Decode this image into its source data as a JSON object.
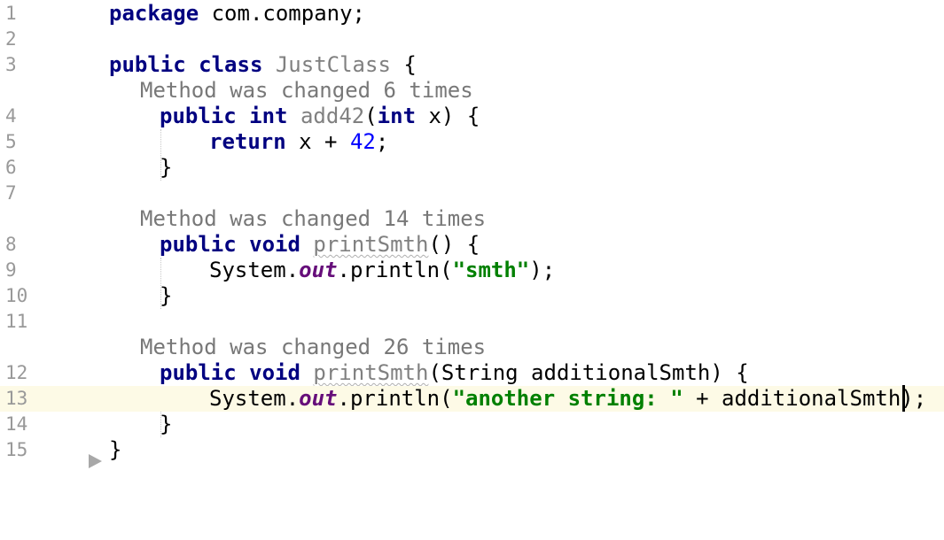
{
  "editor": {
    "lines": {
      "l1": {
        "num": "1",
        "kw": "package",
        "rest": " com.company;"
      },
      "l2": {
        "num": "2"
      },
      "l3": {
        "num": "3",
        "kw1": "public",
        "kw2": "class",
        "name": "JustClass",
        "brace": " {"
      },
      "hint1": "Method was changed 6 times",
      "l4": {
        "num": "4",
        "kw1": "public",
        "kw2": "int",
        "name": "add42",
        "p1": "(",
        "kw3": "int",
        "p2": " x) {"
      },
      "l5": {
        "num": "5",
        "kw": "return",
        "mid": " x + ",
        "value": "42",
        "end": ";"
      },
      "l6": {
        "num": "6",
        "text": "}"
      },
      "l7": {
        "num": "7"
      },
      "hint2": "Method was changed 14 times",
      "l8": {
        "num": "8",
        "kw1": "public",
        "kw2": "void",
        "name": "printSmth",
        "rest": "() {"
      },
      "l9": {
        "num": "9",
        "pre": "System.",
        "field": "out",
        "mid": ".println(",
        "str": "\"smth\"",
        "end": ");"
      },
      "l10": {
        "num": "10",
        "text": "}"
      },
      "l11": {
        "num": "11"
      },
      "hint3": "Method was changed 26 times",
      "l12": {
        "num": "12",
        "kw1": "public",
        "kw2": "void",
        "name": "printSmth",
        "rest": "(String additionalSmth) {"
      },
      "l13": {
        "num": "13",
        "pre": "System.",
        "field": "out",
        "mid": ".println(",
        "str": "\"another string: \"",
        "end": " + additionalSmth);"
      },
      "l14": {
        "num": "14",
        "text": "}"
      },
      "l15": {
        "num": "15",
        "text": "}"
      }
    },
    "fold_icon": "fold-triangle-icon",
    "colors": {
      "keyword": "#000080",
      "number": "#0000ff",
      "string": "#008000",
      "field": "#660e7a",
      "current_line": "#fdfae6"
    }
  }
}
